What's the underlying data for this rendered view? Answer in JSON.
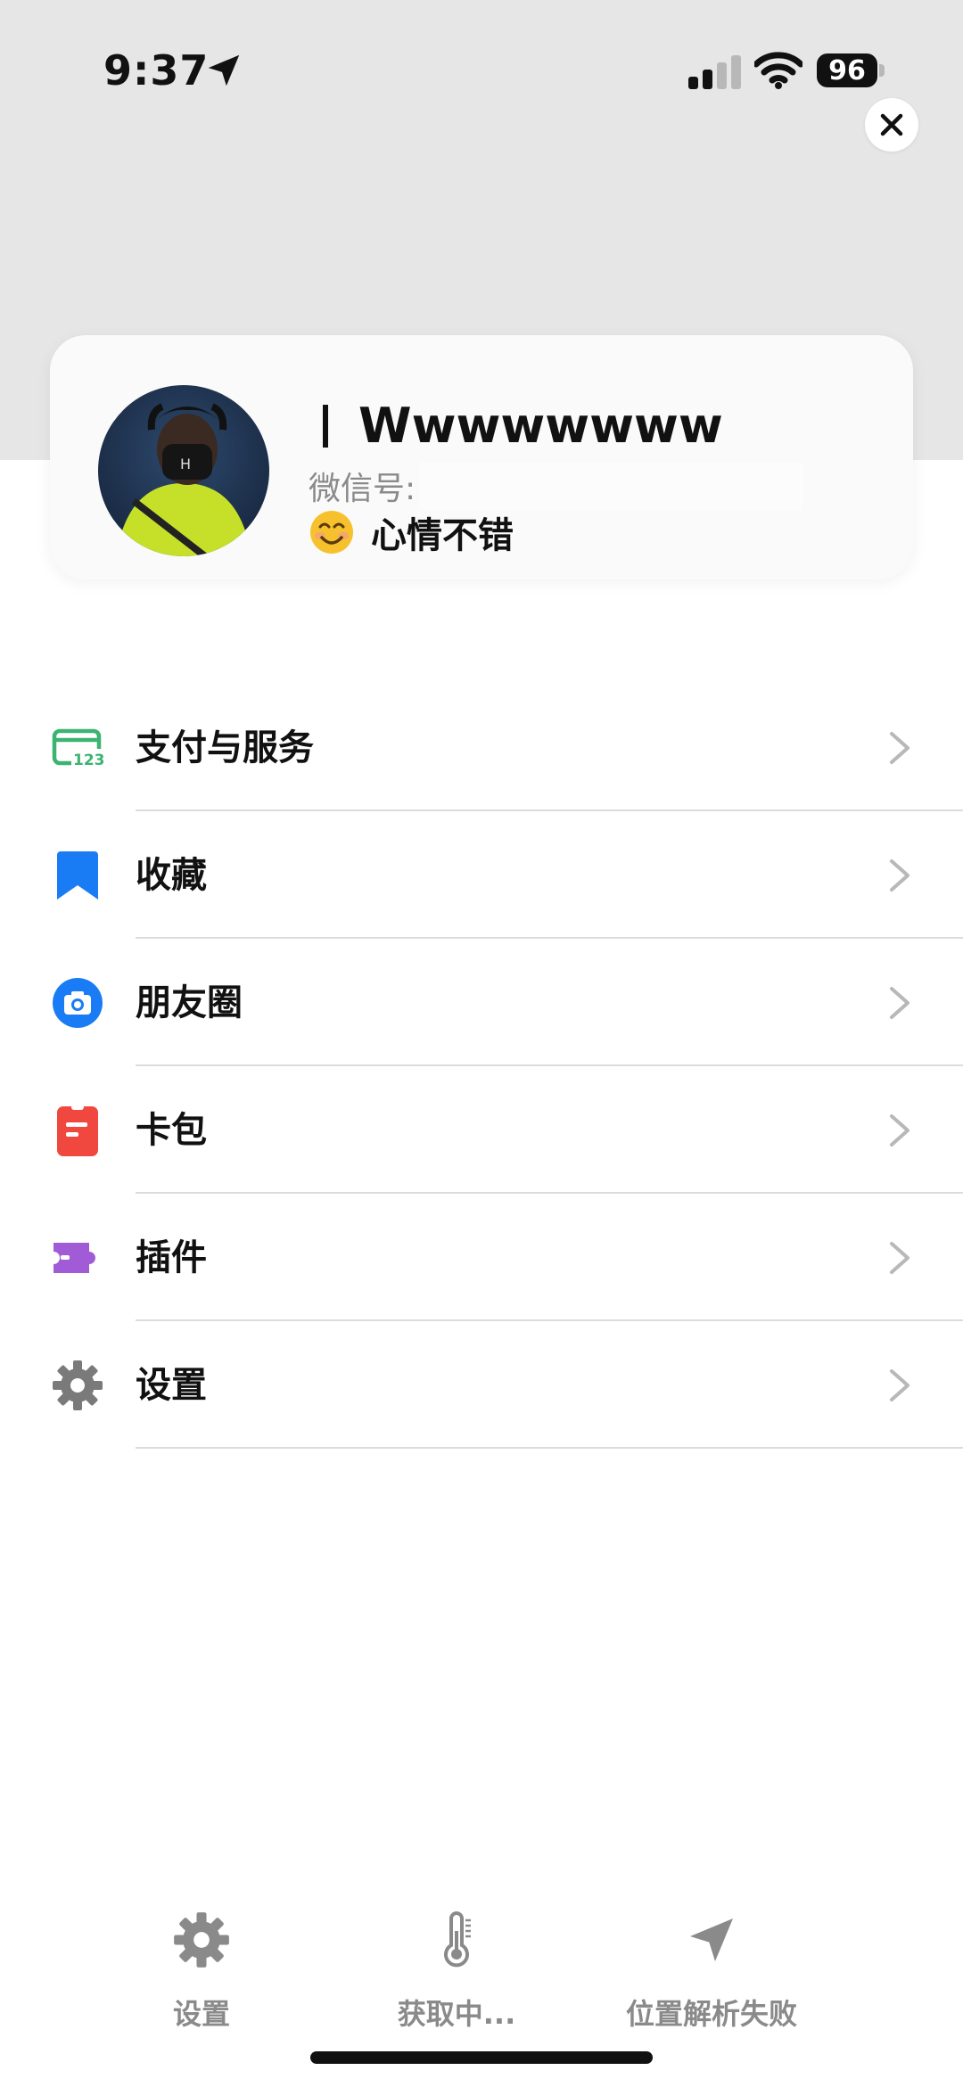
{
  "status_bar": {
    "time": "9:37",
    "battery": "96"
  },
  "profile": {
    "name": "Wwwwwwww",
    "wechat_id_label": "微信号:",
    "status_text": "心情不错"
  },
  "menu": {
    "items": [
      {
        "label": "支付与服务",
        "icon": "payment-card-icon",
        "color": "#3cb371"
      },
      {
        "label": "收藏",
        "icon": "bookmark-icon",
        "color": "#1a7cf5"
      },
      {
        "label": "朋友圈",
        "icon": "camera-icon",
        "color": "#1a7cf5"
      },
      {
        "label": "卡包",
        "icon": "card-wallet-icon",
        "color": "#f0483e"
      },
      {
        "label": "插件",
        "icon": "puzzle-icon",
        "color": "#a15bd6"
      },
      {
        "label": "设置",
        "icon": "gear-icon",
        "color": "#7a7a7a"
      }
    ]
  },
  "dock": {
    "items": [
      {
        "label": "设置",
        "icon": "gear-icon"
      },
      {
        "label": "获取中...",
        "icon": "thermometer-icon"
      },
      {
        "label": "位置解析失败",
        "icon": "location-arrow-icon"
      }
    ]
  }
}
